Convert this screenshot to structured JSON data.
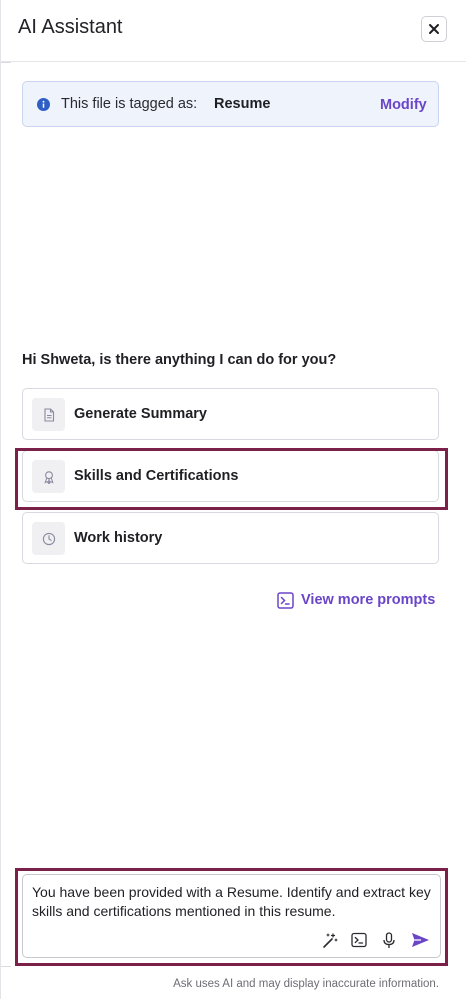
{
  "header": {
    "title": "AI Assistant",
    "close_label": "×"
  },
  "tag_banner": {
    "text": "This file is tagged as:",
    "value": "Resume",
    "action": "Modify"
  },
  "greeting": "Hi Shweta, is there anything I can do for you?",
  "prompts": [
    {
      "label": "Generate Summary",
      "icon": "document-icon"
    },
    {
      "label": "Skills and Certifications",
      "icon": "award-icon"
    },
    {
      "label": "Work history",
      "icon": "clock-icon"
    }
  ],
  "view_more": "View more prompts",
  "composer": {
    "text": "You have been provided with a Resume. Identify and extract key skills and certifications mentioned in this resume.",
    "tools": [
      "magic-wand-icon",
      "terminal-icon",
      "microphone-icon",
      "send-icon"
    ]
  },
  "disclaimer": "Ask uses AI and may display inaccurate information.",
  "colors": {
    "accent": "#6a45c8",
    "highlight": "#7b2149",
    "info": "#2f5fc4",
    "banner_bg": "#eef3fc"
  }
}
